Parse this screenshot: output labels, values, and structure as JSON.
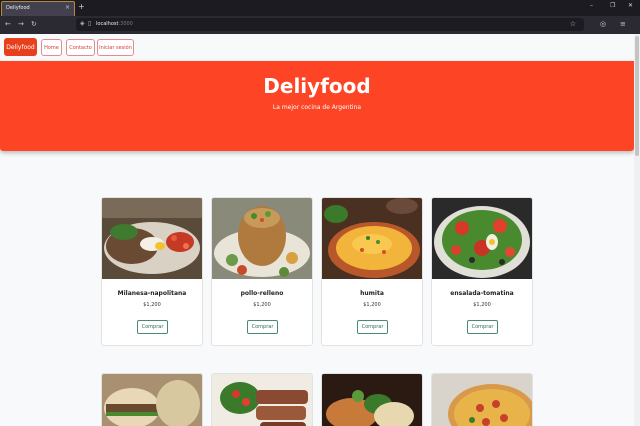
{
  "browser": {
    "tab_title": "Deliyfood",
    "tab_close": "×",
    "new_tab": "+",
    "url_host": "localhost",
    "url_port": ":3000",
    "window_controls": {
      "minimize": "–",
      "maximize": "❐",
      "close": "✕"
    },
    "nav": {
      "back": "←",
      "forward": "→",
      "reload": "↻"
    }
  },
  "navbar": {
    "brand": "Deliyfood",
    "links": [
      {
        "label": "Home"
      },
      {
        "label": "Contacto"
      },
      {
        "label": "Iniciar sesión"
      }
    ]
  },
  "hero": {
    "title": "Deliyfood",
    "subtitle": "La mejor cocina de Argentina"
  },
  "products": [
    {
      "name": "Milanesa-napolitana",
      "price": "$1,200",
      "button": "Comprar"
    },
    {
      "name": "pollo-relleno",
      "price": "$1,200",
      "button": "Comprar"
    },
    {
      "name": "humita",
      "price": "$1,200",
      "button": "Comprar"
    },
    {
      "name": "ensalada-tomatina",
      "price": "$1,200",
      "button": "Comprar"
    }
  ],
  "colors": {
    "brand": "#fd4526",
    "button_border": "#4a8a75",
    "nav_link": "#d23b3b"
  }
}
